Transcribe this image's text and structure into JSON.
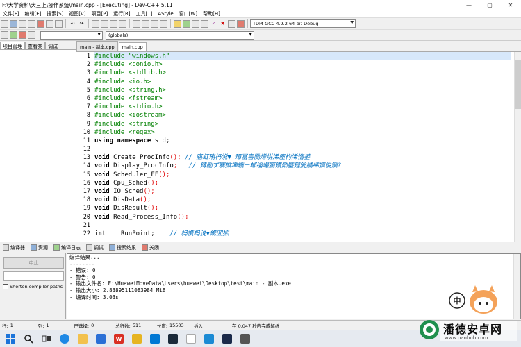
{
  "titlebar": {
    "title": "F:\\大学资料\\大三上\\操作系统\\main.cpp - [Executing] - Dev-C++ 5.11",
    "minimize": "—",
    "maximize": "▢",
    "close": "✕"
  },
  "menu": [
    "文件[F]",
    "编辑[E]",
    "搜索[S]",
    "视图[V]",
    "项目[P]",
    "运行[R]",
    "工具[T]",
    "AStyle",
    "窗口[W]",
    "帮助[H]"
  ],
  "toolbar": {
    "compiler_select": "TDM-GCC 4.9.2 64-bit Debug",
    "scope_select": "(globals)"
  },
  "left_tabs": [
    "项目管理",
    "查看类",
    "调试"
  ],
  "editor_tabs": [
    "main - 副本.cpp",
    "main.cpp"
  ],
  "code": [
    {
      "n": "1",
      "html": "<span class='pp'>#include \"windows.h\"</span>",
      "hl": true
    },
    {
      "n": "2",
      "html": "<span class='pp'>#include &lt;conio.h&gt;</span>"
    },
    {
      "n": "3",
      "html": "<span class='pp'>#include &lt;stdlib.h&gt;</span>"
    },
    {
      "n": "4",
      "html": "<span class='pp'>#include &lt;io.h&gt;</span>"
    },
    {
      "n": "5",
      "html": "<span class='pp'>#include &lt;string.h&gt;</span>"
    },
    {
      "n": "6",
      "html": "<span class='pp'>#include &lt;fstream&gt;</span>"
    },
    {
      "n": "7",
      "html": "<span class='pp'>#include &lt;stdio.h&gt;</span>"
    },
    {
      "n": "8",
      "html": "<span class='pp'>#include &lt;iostream&gt;</span>"
    },
    {
      "n": "9",
      "html": "<span class='pp'>#include &lt;string&gt;</span>"
    },
    {
      "n": "10",
      "html": "<span class='pp'>#include &lt;regex&gt;</span>"
    },
    {
      "n": "11",
      "html": "<span class='kw'>using namespace</span> std;"
    },
    {
      "n": "12",
      "html": ""
    },
    {
      "n": "13",
      "html": "<span class='kw'>void</span> Create_ProcInfo<span class='sym'>();</span> <span class='cm'>// 寤虹珛杩涚▼ 璋冨害闃熷垪浠庢枃浠惰鍙</span>"
    },
    {
      "n": "14",
      "html": "<span class='kw'>void</span> Display_ProcInfo<span class='sym'>;</span>   <span class='cm'>// 鏄剧ず褰撳墠鍦ㄧ郴缁熶腑鐨勬墍鏈夎繘绋嬩俊鎭?</span>"
    },
    {
      "n": "15",
      "html": "<span class='kw'>void</span> Scheduler_FF<span class='sym'>();</span>"
    },
    {
      "n": "16",
      "html": "<span class='kw'>void</span> Cpu_Sched<span class='sym'>();</span>"
    },
    {
      "n": "17",
      "html": "<span class='kw'>void</span> IO_Sched<span class='sym'>();</span>"
    },
    {
      "n": "18",
      "html": "<span class='kw'>void</span> DisData<span class='sym'>();</span>"
    },
    {
      "n": "19",
      "html": "<span class='kw'>void</span> DisResult<span class='sym'>();</span>"
    },
    {
      "n": "20",
      "html": "<span class='kw'>void</span> Read_Process_Info<span class='sym'>();</span>"
    },
    {
      "n": "21",
      "html": ""
    },
    {
      "n": "22",
      "html": "<span class='kw'>int</span>    RunPoint;    <span class='cm'>// 杩愯杩涚▼鎸囬拡</span>"
    }
  ],
  "bottom_tabs": [
    "编译器",
    "资源",
    "编译日志",
    "调试",
    "搜索结果",
    "关闭"
  ],
  "bottom_left": {
    "abort_label": "中止",
    "shorten_label": "Shorten compiler paths"
  },
  "output_lines": [
    "编译结果...",
    "--------",
    "- 错误: 0",
    "- 警告: 0",
    "- 输出文件名: F:\\HuaweiMoveData\\Users\\huawei\\Desktop\\test\\main - 副本.exe",
    "- 输出大小: 2.83895111083984 MiB",
    "- 编译时间: 3.03s"
  ],
  "status": {
    "row_label": "行:",
    "row_value": "1",
    "col_label": "列:",
    "col_value": "1",
    "sel_label": "已选择:",
    "sel_value": "0",
    "total_label": "总行数:",
    "total_value": "511",
    "len_label": "长度:",
    "len_value": "15503",
    "mode": "插入",
    "parse": "在 0.047 秒内完成解析"
  },
  "taskbar_icons": [
    "windows-start",
    "search",
    "task-view",
    "edge",
    "explorer",
    "mail",
    "wps",
    "files",
    "store",
    "app",
    "devcpp",
    "vscode",
    "app2",
    "app3"
  ],
  "watermark": {
    "text": "潘德安卓网",
    "url": "www.panhub.com"
  }
}
